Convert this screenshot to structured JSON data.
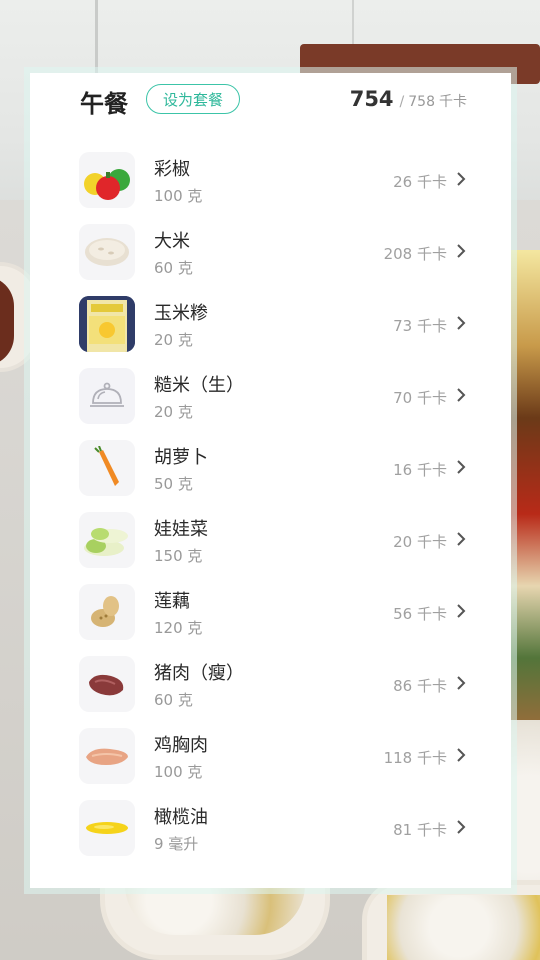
{
  "meal": {
    "title": "午餐",
    "set_button": "设为套餐",
    "kcal_eaten": "754",
    "kcal_slash": "/",
    "kcal_goal": "758",
    "kcal_unit": "千卡"
  },
  "foods": [
    {
      "name": "彩椒",
      "amount": "100 克",
      "kcal": "26 千卡",
      "icon": "bell-pepper-icon"
    },
    {
      "name": "大米",
      "amount": "60 克",
      "kcal": "208 千卡",
      "icon": "rice-icon"
    },
    {
      "name": "玉米糁",
      "amount": "20 克",
      "kcal": "73 千卡",
      "icon": "corn-grits-bag-icon"
    },
    {
      "name": "糙米（生）",
      "amount": "20 克",
      "kcal": "70 千卡",
      "icon": "food-cloche-icon"
    },
    {
      "name": "胡萝卜",
      "amount": "50 克",
      "kcal": "16 千卡",
      "icon": "carrot-icon"
    },
    {
      "name": "娃娃菜",
      "amount": "150 克",
      "kcal": "20 千卡",
      "icon": "baby-cabbage-icon"
    },
    {
      "name": "莲藕",
      "amount": "120 克",
      "kcal": "56 千卡",
      "icon": "lotus-root-icon"
    },
    {
      "name": "猪肉（瘦）",
      "amount": "60 克",
      "kcal": "86 千卡",
      "icon": "lean-pork-icon"
    },
    {
      "name": "鸡胸肉",
      "amount": "100 克",
      "kcal": "118 千卡",
      "icon": "chicken-breast-icon"
    },
    {
      "name": "橄榄油",
      "amount": "9 毫升",
      "kcal": "81 千卡",
      "icon": "olive-oil-icon"
    }
  ],
  "colors": {
    "accent": "#2fb89b",
    "text_primary": "#2a2a2a",
    "text_secondary": "#999999"
  }
}
